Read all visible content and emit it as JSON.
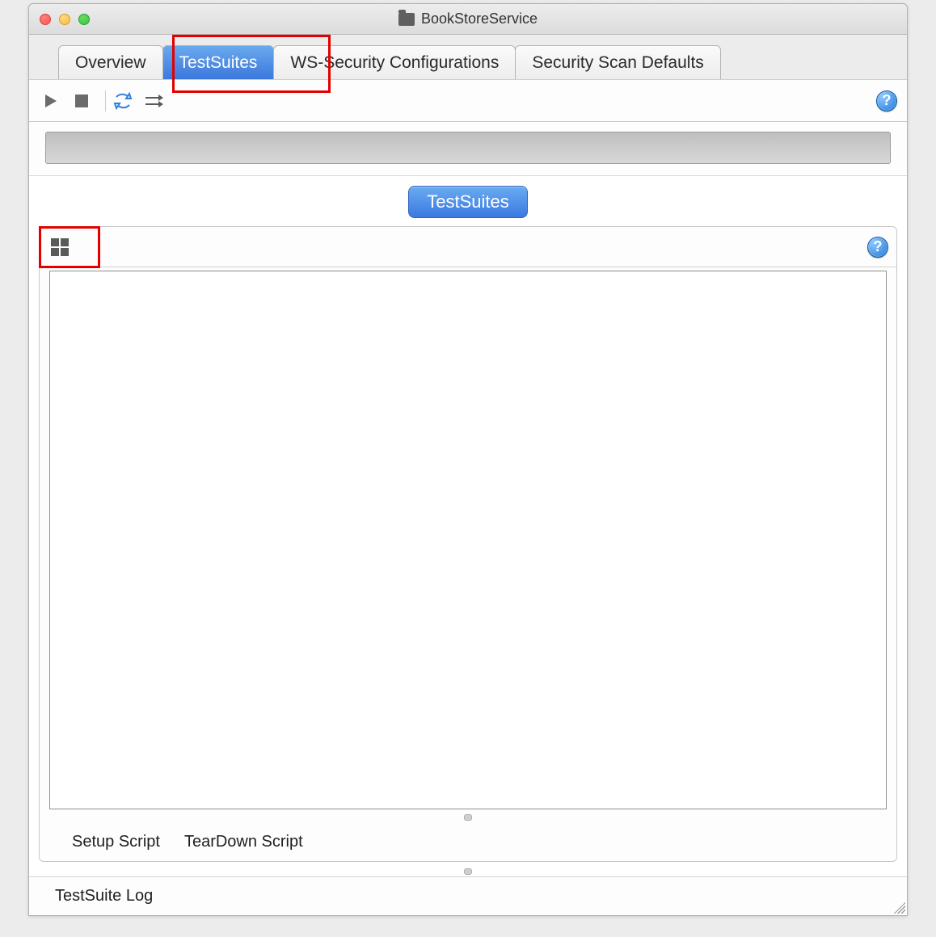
{
  "window": {
    "title": "BookStoreService"
  },
  "tabs": {
    "items": [
      {
        "label": "Overview",
        "active": false
      },
      {
        "label": "TestSuites",
        "active": true
      },
      {
        "label": "WS-Security Configurations",
        "active": false
      },
      {
        "label": "Security Scan Defaults",
        "active": false
      }
    ]
  },
  "panel": {
    "header_label": "TestSuites",
    "setup_label": "Setup Script",
    "teardown_label": "TearDown Script"
  },
  "footer": {
    "log_label": "TestSuite Log"
  }
}
